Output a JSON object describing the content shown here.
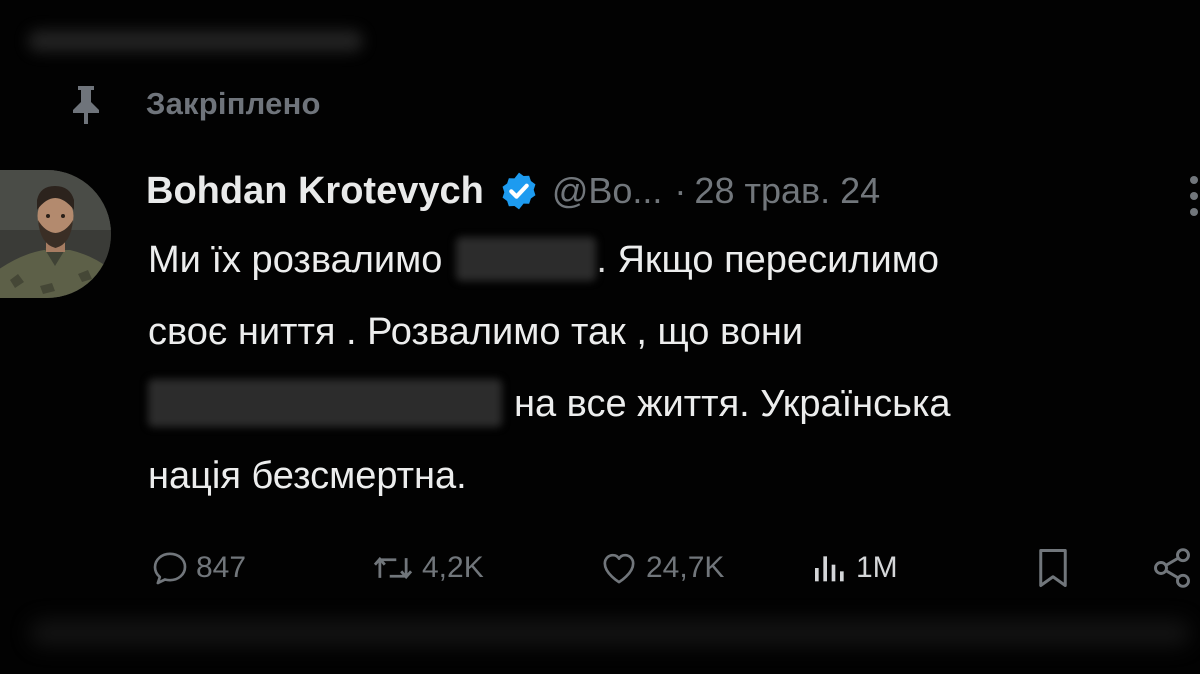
{
  "pinned": {
    "label": "Закріплено",
    "icon": "pin-icon"
  },
  "tweet": {
    "author_name": "Bohdan Krotevych",
    "verified": true,
    "handle": "@Bo...",
    "separator": "·",
    "timestamp": "28 трав. 24",
    "text_lines": [
      {
        "before": "Ми їх  розвалимо",
        "after": ". Якщо пересилимо"
      },
      {
        "text": "своє ниття . Розвалимо так , що вони"
      },
      {
        "after": "на все життя. Українська"
      },
      {
        "text": "нація безсмертна."
      }
    ]
  },
  "actions": {
    "replies": "847",
    "reposts": "4,2K",
    "likes": "24,7K",
    "views": "1M",
    "icons": [
      "reply-icon",
      "repost-icon",
      "like-icon",
      "views-icon",
      "bookmark-icon",
      "share-icon"
    ]
  },
  "colors": {
    "background": "#000000",
    "text_primary": "#e9eaea",
    "text_secondary": "#71767b",
    "verified_blue": "#1d9bf0"
  }
}
